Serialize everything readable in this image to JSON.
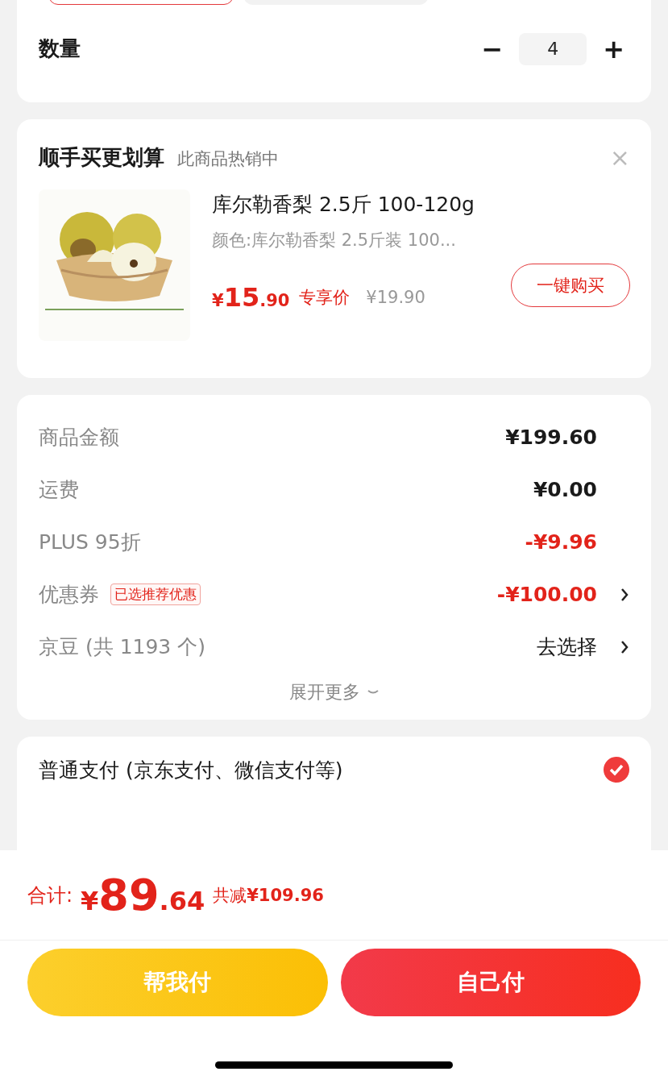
{
  "option_chips": [
    {
      "selected": true
    },
    {
      "selected": false
    }
  ],
  "quantity": {
    "label": "数量",
    "minus": "−",
    "value": "4",
    "plus": "+"
  },
  "upsell": {
    "title": "顺手买更划算",
    "subtitle": "此商品热销中",
    "close": "×",
    "product": {
      "kind": "picture",
      "name": "库尔勒香梨 2.5斤 100-120g",
      "spec": "颜色:库尔勒香梨 2.5斤装 100...",
      "price": {
        "currency": "¥",
        "integer": "15",
        "decimal": ".90"
      },
      "price_label": "专享价",
      "original_price": "¥19.90",
      "button": "一键购买"
    }
  },
  "summary": {
    "rows": [
      {
        "label": "商品金额",
        "value": "¥199.60",
        "kind": "amount",
        "chevron": false
      },
      {
        "label": "运费",
        "value": "¥0.00",
        "kind": "amount",
        "chevron": false
      },
      {
        "label": "PLUS 95折",
        "value": "-¥9.96",
        "kind": "discount",
        "chevron": false
      },
      {
        "label": "优惠券",
        "badge": "已选推荐优惠",
        "value": "-¥100.00",
        "kind": "discount",
        "chevron": true
      },
      {
        "label": "京豆 (共 1193 个)",
        "value": "去选择",
        "kind": "action",
        "chevron": true
      }
    ],
    "expand": "展开更多"
  },
  "payment": {
    "options": [
      {
        "label": "普通支付 (京东支付、微信支付等)",
        "selected": true
      }
    ]
  },
  "footer": {
    "total_label": "合计:",
    "currency": "¥",
    "integer": "89",
    "decimal": ".64",
    "savings": "共减**¥109.96**",
    "buttons": [
      {
        "label": "帮我付",
        "kind": "secondary"
      },
      {
        "label": "自己付",
        "kind": "primary"
      }
    ]
  }
}
